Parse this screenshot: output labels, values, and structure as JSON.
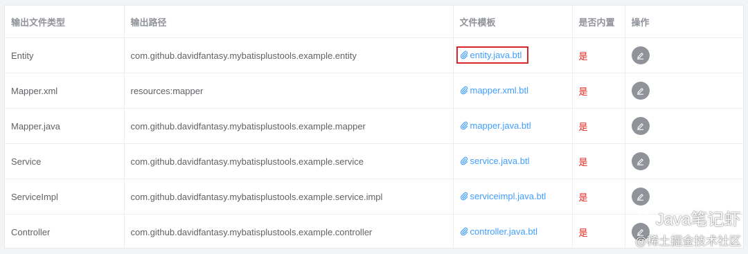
{
  "table": {
    "headers": [
      "输出文件类型",
      "输出路径",
      "文件模板",
      "是否内置",
      "操作"
    ],
    "rows": [
      {
        "type": "Entity",
        "path": "com.github.davidfantasy.mybatisplustools.example.entity",
        "template": "entity.java.btl",
        "builtin": "是"
      },
      {
        "type": "Mapper.xml",
        "path": "resources:mapper",
        "template": "mapper.xml.btl",
        "builtin": "是"
      },
      {
        "type": "Mapper.java",
        "path": "com.github.davidfantasy.mybatisplustools.example.mapper",
        "template": "mapper.java.btl",
        "builtin": "是"
      },
      {
        "type": "Service",
        "path": "com.github.davidfantasy.mybatisplustools.example.service",
        "template": "service.java.btl",
        "builtin": "是"
      },
      {
        "type": "ServiceImpl",
        "path": "com.github.davidfantasy.mybatisplustools.example.service.impl",
        "template": "serviceimpl.java.btl",
        "builtin": "是"
      },
      {
        "type": "Controller",
        "path": "com.github.davidfantasy.mybatisplustools.example.controller",
        "template": "controller.java.btl",
        "builtin": "是"
      }
    ]
  },
  "icons": {
    "template_link": "paperclip-icon",
    "edit_action": "pencil-icon",
    "watermark": "wechat-icon"
  },
  "colors": {
    "link": "#409eff",
    "builtin": "#e2231a",
    "edit_button": "#909399",
    "highlight_box": "#d9262b",
    "header_text": "#909399",
    "cell_text": "#606266"
  },
  "watermark": {
    "line1": "Java笔记虾",
    "line2": "@稀土掘金技术社区"
  }
}
